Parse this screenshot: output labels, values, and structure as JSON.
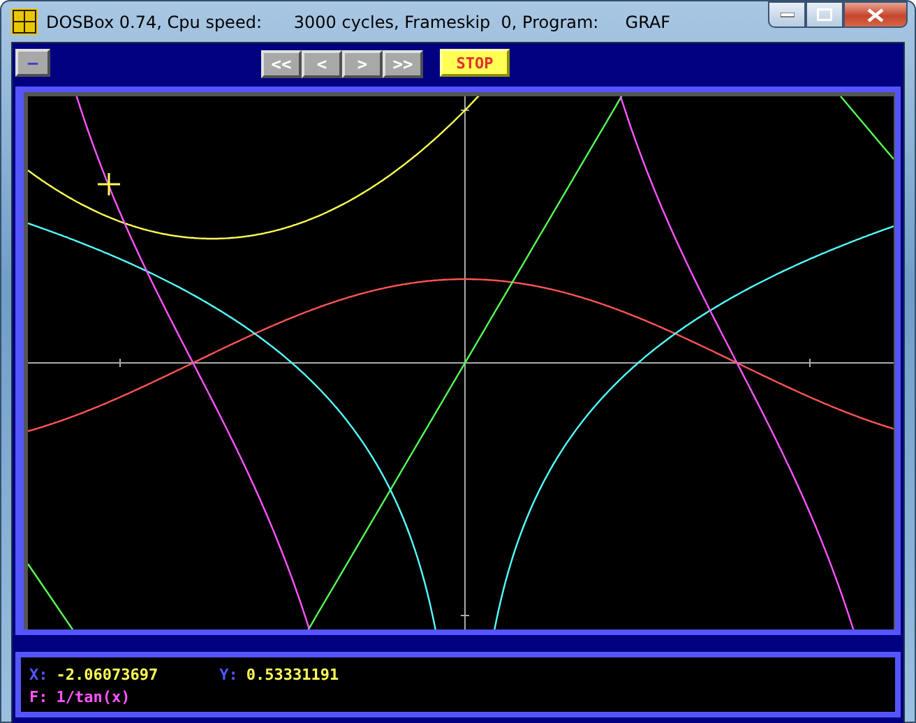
{
  "window": {
    "title": "DOSBox 0.74, Cpu speed:      3000 cycles, Frameskip  0, Program:     GRAF"
  },
  "toolbar": {
    "menu_button": "–",
    "nav_buttons": [
      "<<",
      "<",
      ">",
      ">>"
    ],
    "stop_button": "STOP"
  },
  "status": {
    "x_label": "X:",
    "x_value": "-2.06073697",
    "y_label": "Y:",
    "y_value": "0.53331191",
    "function_label": "F:",
    "function": "1/tan(x)"
  }
}
